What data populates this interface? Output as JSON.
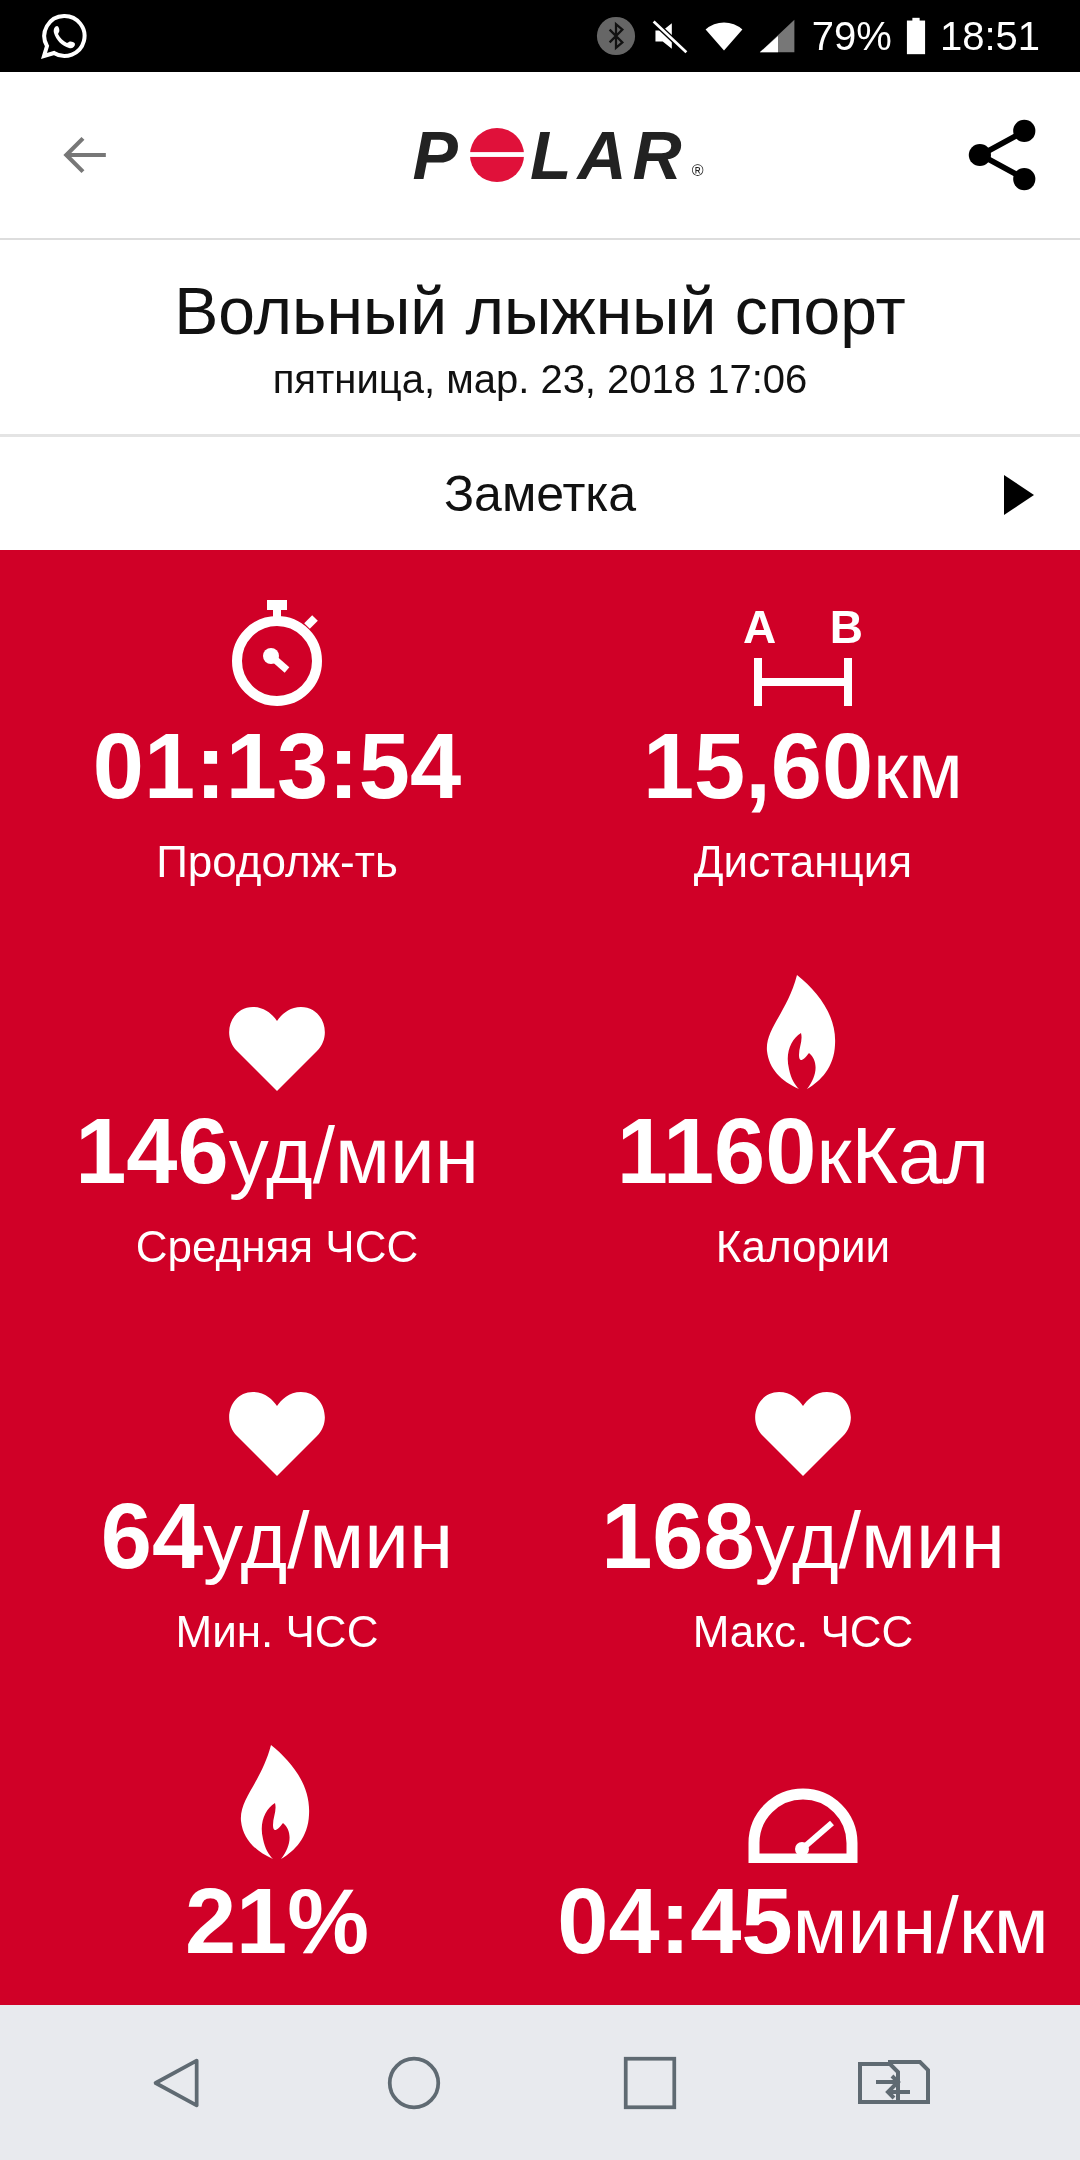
{
  "status_bar": {
    "battery": "79%",
    "time": "18:51"
  },
  "header": {
    "logo": {
      "left": "P",
      "right": "LAR",
      "mark": "®"
    }
  },
  "workout": {
    "title": "Вольный лыжный спорт",
    "date": "пятница, мар. 23, 2018 17:06"
  },
  "note": {
    "label": "Заметка"
  },
  "distance_icon": {
    "letters": [
      "A",
      "B"
    ]
  },
  "stats": [
    {
      "kind": "stopwatch",
      "value": "01:13:54",
      "label": "Продолж-ть"
    },
    {
      "kind": "distance",
      "value": "15,60",
      "unit": "км",
      "label": "Дистанция"
    },
    {
      "kind": "heart",
      "value": "146",
      "unit": "уд/мин",
      "label": "Средняя ЧСС"
    },
    {
      "kind": "flame",
      "value": "1160",
      "unit": "кКал",
      "label": "Калории"
    },
    {
      "kind": "heart",
      "value": "64",
      "unit": "уд/мин",
      "label": "Мин. ЧСС"
    },
    {
      "kind": "heart",
      "value": "168",
      "unit": "уд/мин",
      "label": "Макс. ЧСС"
    },
    {
      "kind": "flame",
      "value": "21%"
    },
    {
      "kind": "gauge",
      "value": "04:45",
      "unit": "мин/км"
    }
  ]
}
